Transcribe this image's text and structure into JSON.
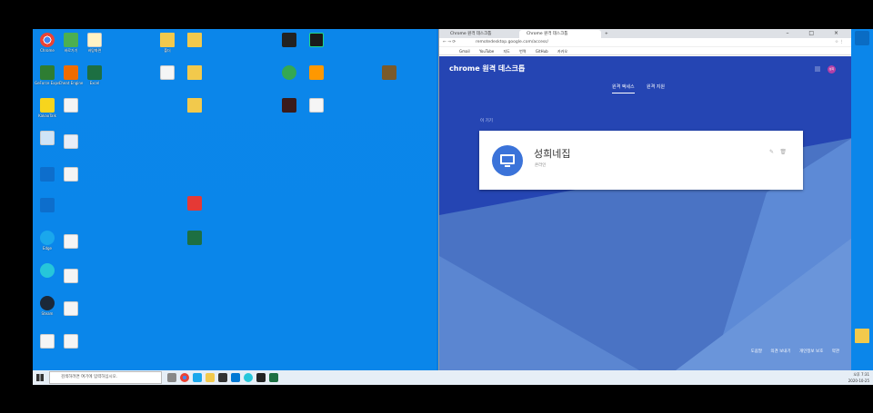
{
  "desktop": {
    "icons": [
      {
        "label": "Chrome",
        "color": "#ffffff",
        "kind": "app"
      },
      {
        "label": "바로가기",
        "color": "#4caf50",
        "kind": "app"
      },
      {
        "label": "바탕화면",
        "color": "#e7c86e",
        "kind": "doc"
      },
      {
        "label": "폴더",
        "color": "#f2c94c",
        "kind": "folder"
      },
      {
        "label": "GeForce Experience",
        "color": "#2e7d32",
        "kind": "app"
      },
      {
        "label": "Cheat Engine",
        "color": "#ef6c00",
        "kind": "app"
      },
      {
        "label": "Excel",
        "color": "#1d6f42",
        "kind": "app"
      },
      {
        "label": "KakaoTalk",
        "color": "#f7d51d",
        "kind": "app"
      },
      {
        "label": "Steam",
        "color": "#1b2838",
        "kind": "app"
      },
      {
        "label": "Edge",
        "color": "#1aa7ec",
        "kind": "app"
      }
    ]
  },
  "chrome": {
    "tabs": [
      {
        "label": "Chrome 원격 데스크톱"
      },
      {
        "label": "Chrome 원격 데스크톱"
      }
    ],
    "new_tab": "+",
    "window_controls": "– □ ×",
    "url": "remotedesktop.google.com/access/",
    "bookmarks": [
      "Gmail",
      "YouTube",
      "지도",
      "번역",
      "GitHub",
      "카카오"
    ]
  },
  "page": {
    "brand": "chrome 원격 데스크톱",
    "avatar": "성희",
    "tabs": [
      "원격 액세스",
      "원격 지원"
    ],
    "section_title": "이 기기",
    "device": {
      "name": "성희네집",
      "status": "온라인"
    },
    "footer": [
      "도움말",
      "의견 보내기",
      "개인정보 보호",
      "약관"
    ]
  },
  "taskbar": {
    "search_placeholder": "검색하려면 여기에 입력하십시오.",
    "clock_time": "오후 7:31",
    "clock_date": "2020-10-25"
  },
  "colors": {
    "page_bg": "#2545b3",
    "accent": "#3b73d9",
    "desktop": "#0b86ea"
  }
}
